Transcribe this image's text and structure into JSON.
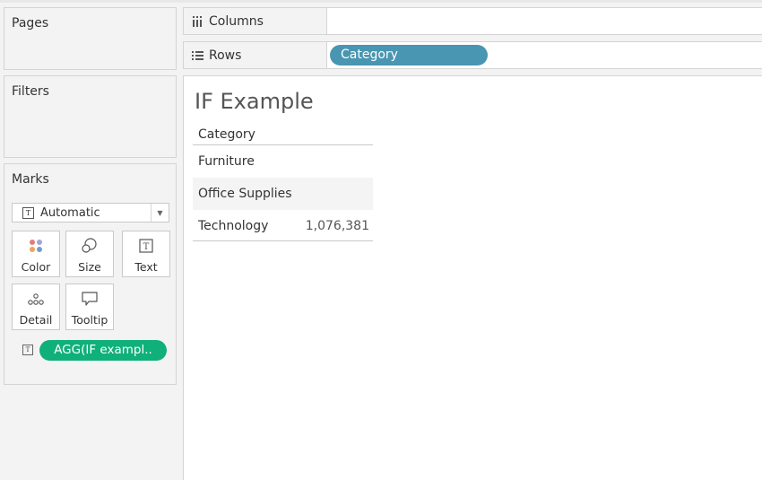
{
  "cards": {
    "pages": "Pages",
    "filters": "Filters",
    "marks": "Marks"
  },
  "marks": {
    "type": "Automatic",
    "buttons": [
      "Color",
      "Size",
      "Text",
      "Detail",
      "Tooltip"
    ],
    "field_pill": "AGG(IF exampl.."
  },
  "shelves": {
    "columns_label": "Columns",
    "rows_label": "Rows",
    "rows_pill": "Category"
  },
  "view": {
    "title": "IF Example",
    "table": {
      "header": "Category",
      "rows": [
        {
          "category": "Furniture",
          "value": ""
        },
        {
          "category": "Office Supplies",
          "value": ""
        },
        {
          "category": "Technology",
          "value": "1,076,381"
        }
      ]
    }
  },
  "colors": {
    "rows_pill": "#4996b2",
    "field_pill": "#10b07b"
  }
}
